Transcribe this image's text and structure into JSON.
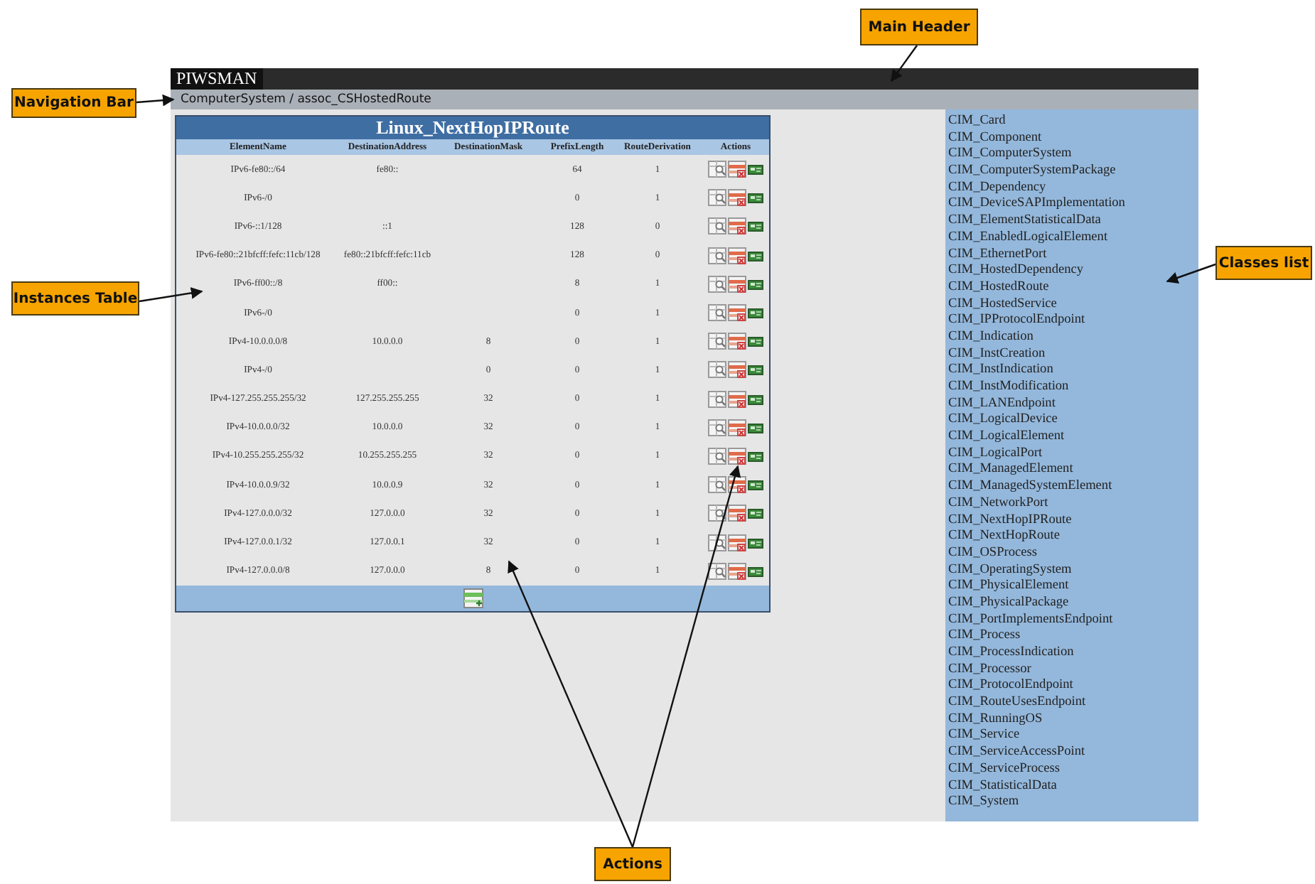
{
  "header": {
    "title": "PIWSMAN"
  },
  "nav": {
    "path": "ComputerSystem / assoc_CSHostedRoute"
  },
  "table": {
    "title": "Linux_NextHopIPRoute",
    "columns": [
      "ElementName",
      "DestinationAddress",
      "DestinationMask",
      "PrefixLength",
      "RouteDerivation",
      "Actions"
    ],
    "rows": [
      [
        "IPv6-fe80::/64",
        "fe80::",
        "",
        "64",
        "1"
      ],
      [
        "IPv6-/0",
        "",
        "",
        "0",
        "1"
      ],
      [
        "IPv6-::1/128",
        "::1",
        "",
        "128",
        "0"
      ],
      [
        "IPv6-fe80::21bfcff:fefc:11cb/128",
        "fe80::21bfcff:fefc:11cb",
        "",
        "128",
        "0"
      ],
      [
        "IPv6-ff00::/8",
        "ff00::",
        "",
        "8",
        "1"
      ],
      [
        "IPv6-/0",
        "",
        "",
        "0",
        "1"
      ],
      [
        "IPv4-10.0.0.0/8",
        "10.0.0.0",
        "8",
        "0",
        "1"
      ],
      [
        "IPv4-/0",
        "",
        "0",
        "0",
        "1"
      ],
      [
        "IPv4-127.255.255.255/32",
        "127.255.255.255",
        "32",
        "0",
        "1"
      ],
      [
        "IPv4-10.0.0.0/32",
        "10.0.0.0",
        "32",
        "0",
        "1"
      ],
      [
        "IPv4-10.255.255.255/32",
        "10.255.255.255",
        "32",
        "0",
        "1"
      ],
      [
        "IPv4-10.0.0.9/32",
        "10.0.0.9",
        "32",
        "0",
        "1"
      ],
      [
        "IPv4-127.0.0.0/32",
        "127.0.0.0",
        "32",
        "0",
        "1"
      ],
      [
        "IPv4-127.0.0.1/32",
        "127.0.0.1",
        "32",
        "0",
        "1"
      ],
      [
        "IPv4-127.0.0.0/8",
        "127.0.0.0",
        "8",
        "0",
        "1"
      ]
    ]
  },
  "classes": [
    "CIM_Card",
    "CIM_Component",
    "CIM_ComputerSystem",
    "CIM_ComputerSystemPackage",
    "CIM_Dependency",
    "CIM_DeviceSAPImplementation",
    "CIM_ElementStatisticalData",
    "CIM_EnabledLogicalElement",
    "CIM_EthernetPort",
    "CIM_HostedDependency",
    "CIM_HostedRoute",
    "CIM_HostedService",
    "CIM_IPProtocolEndpoint",
    "CIM_Indication",
    "CIM_InstCreation",
    "CIM_InstIndication",
    "CIM_InstModification",
    "CIM_LANEndpoint",
    "CIM_LogicalDevice",
    "CIM_LogicalElement",
    "CIM_LogicalPort",
    "CIM_ManagedElement",
    "CIM_ManagedSystemElement",
    "CIM_NetworkPort",
    "CIM_NextHopIPRoute",
    "CIM_NextHopRoute",
    "CIM_OSProcess",
    "CIM_OperatingSystem",
    "CIM_PhysicalElement",
    "CIM_PhysicalPackage",
    "CIM_PortImplementsEndpoint",
    "CIM_Process",
    "CIM_ProcessIndication",
    "CIM_Processor",
    "CIM_ProtocolEndpoint",
    "CIM_RouteUsesEndpoint",
    "CIM_RunningOS",
    "CIM_Service",
    "CIM_ServiceAccessPoint",
    "CIM_ServiceProcess",
    "CIM_StatisticalData",
    "CIM_System"
  ],
  "annotations": [
    "Main Header",
    "Navigation Bar",
    "Instances Table",
    "Classes list",
    "Actions"
  ]
}
